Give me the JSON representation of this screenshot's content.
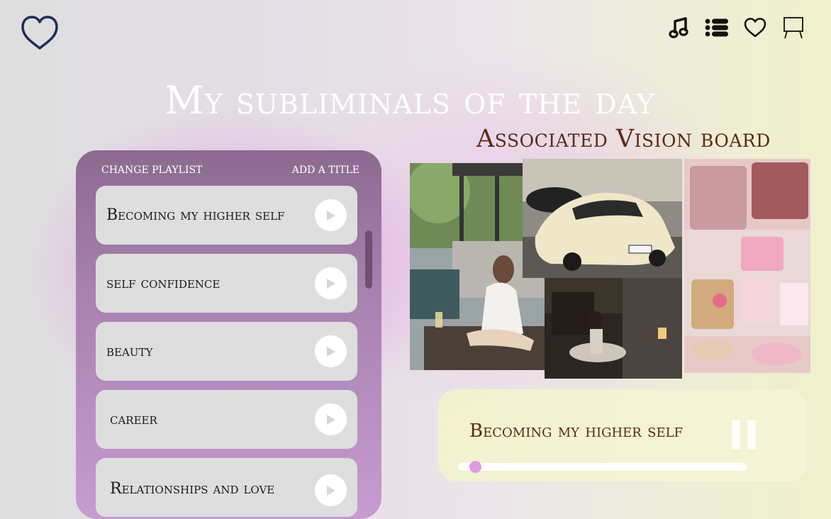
{
  "header": {
    "logo_icon": "heart-outline-icon",
    "nav_icons": [
      "music-note-icon",
      "list-icon",
      "heart-icon",
      "easel-icon"
    ]
  },
  "page": {
    "title": "My subliminals of the day",
    "vision_board_title": "Associated Vision board"
  },
  "playlist": {
    "change_label": "CHANGE PLAYLIST",
    "add_title_label": "ADD A TITLE",
    "tracks": [
      {
        "name": "Becoming my higher self"
      },
      {
        "name": "self confidence"
      },
      {
        "name": "beauty"
      },
      {
        "name": "career"
      },
      {
        "name": "Relationships and love"
      }
    ]
  },
  "vision_board": {
    "images": [
      "woman-meditating-poolside",
      "cream-sports-car",
      "woman-working-at-desk",
      "pink-handbags-and-accessories"
    ]
  },
  "player": {
    "now_playing": "Becoming my higher self",
    "state": "playing",
    "progress": 0.06
  },
  "colors": {
    "accent_pink": "#e19ae5",
    "title_brown": "#5a2a16",
    "panel_purple": "#a982b0"
  }
}
